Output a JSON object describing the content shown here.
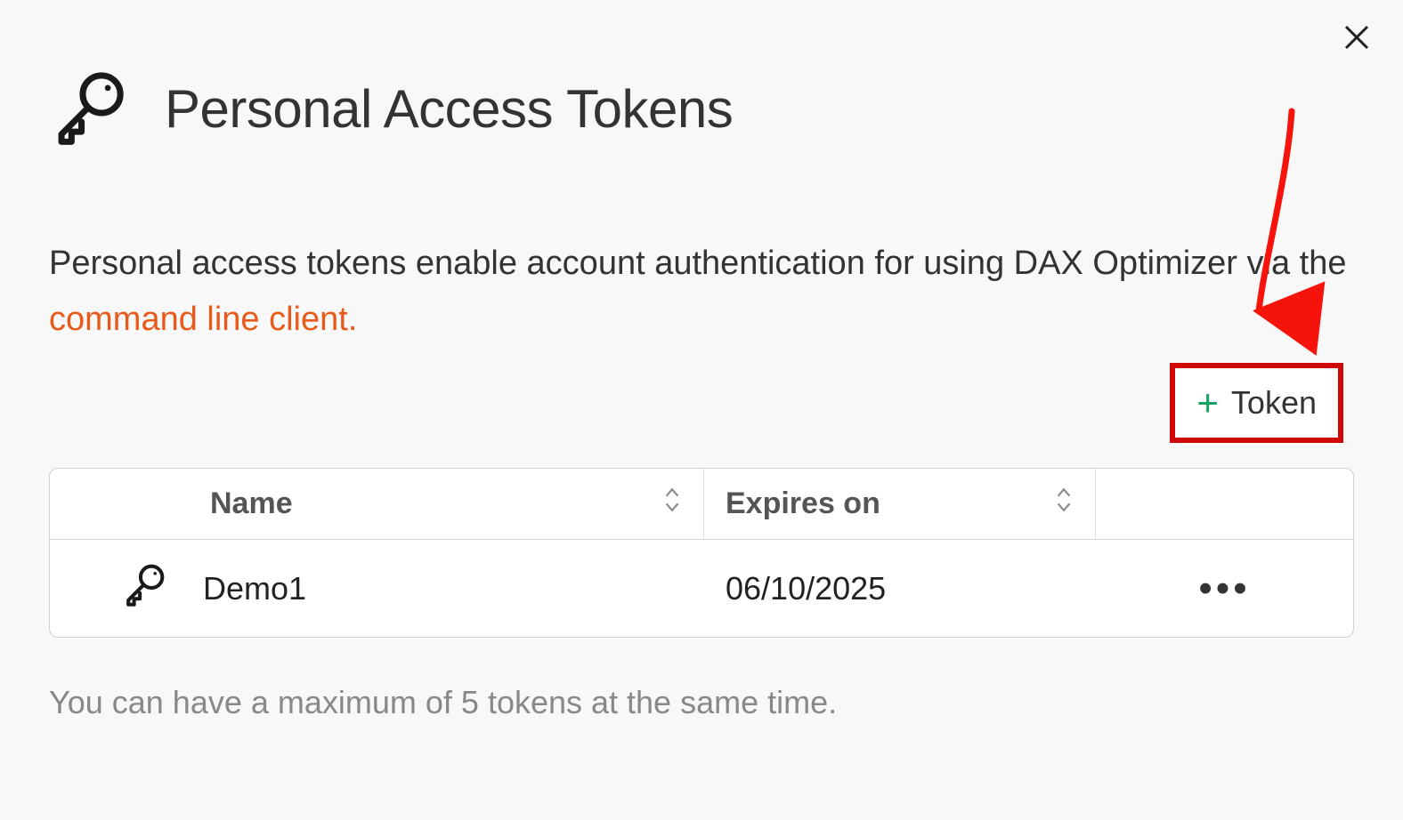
{
  "header": {
    "title": "Personal Access Tokens"
  },
  "description": {
    "text_before": "Personal access tokens enable account authentication for using DAX Optimizer via the ",
    "link_text": "command line client.",
    "text_after": ""
  },
  "add_button": {
    "label": "Token"
  },
  "table": {
    "columns": {
      "name": "Name",
      "expires": "Expires on"
    },
    "rows": [
      {
        "name": "Demo1",
        "expires": "06/10/2025"
      }
    ]
  },
  "footer": {
    "note": "You can have a maximum of 5 tokens at the same time."
  }
}
